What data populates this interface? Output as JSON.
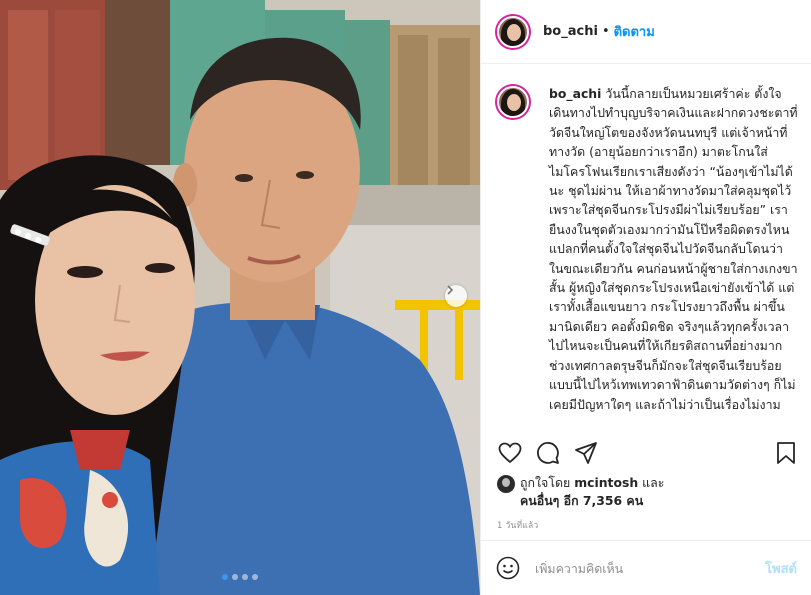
{
  "app": {
    "brand_color": "#0095f6",
    "ring_color": "#d6249f"
  },
  "post_header": {
    "username": "bo_achi",
    "separator": "•",
    "follow_label": "ติดตาม"
  },
  "media": {
    "next_icon": "chevron-right-icon",
    "slide_count": 4,
    "active_slide": 1
  },
  "caption": {
    "username": "bo_achi",
    "text": "วันนี้กลายเป็นหมวยเศร้าค่ะ ตั้งใจเดินทางไปทำบุญบริจาคเงินและฝากดวงชะตาที่วัดจีนใหญ่โตของจังหวัดนนทบุรี แต่เจ้าหน้าที่ทางวัด (อายุน้อยกว่าเราอีก) มาตะโกนใส่ไมโครโฟนเรียกเราเสียงดังว่า “น้องๆเข้าไม่ได้นะ ชุดไม่ผ่าน ให้เอาผ้าทางวัดมาใส่คลุมชุดไว้ เพราะใส่ชุดจีนกระโปรงมีผ่าไม่เรียบร้อย” เรายืนงงในชุดตัวเองมากว่ามันโป๊หรือผิดตรงไหน แปลกที่คนตั้งใจใส่ชุดจีนไปวัดจีนกลับโดนว่า ในขณะเดียวกัน คนก่อนหน้าผู้ชายใส่กางเกงขาสั้น ผู้หญิงใส่ชุดกระโปรงเหนือเข่ายังเข้าได้ แต่เราทั้งเสื้อแขนยาว กระโปรงยาวถึงพื้น ผ่าขึ้นมานิดเดียว คอตั้งมิดชิด จริงๆแล้วทุกครั้งเวลาไปไหนจะเป็นคนที่ให้เกียรติสถานที่อย่างมาก ช่วงเทศกาลตรุษจีนก็มักจะใส่ชุดจีนเรียบร้อยแบบนี้ไปไหว้เทพเทวดาฟ้าดินตามวัดต่างๆ ก็ไม่เคยมีปัญหาใดๆ และถ้าไม่ว่าเป็นเรื่องไม่งาม"
  },
  "actions": {
    "like_icon": "heart-icon",
    "comment_icon": "speech-bubble-icon",
    "share_icon": "paper-plane-icon",
    "save_icon": "bookmark-icon"
  },
  "likes": {
    "prefix": "ถูกใจโดย",
    "first_user": "mcintosh",
    "conjunction": "และ",
    "others_label": "คนอื่นๆ อีก 7,356 คน"
  },
  "timestamp": "1 วันที่แล้ว",
  "comment_box": {
    "emoji_icon": "smiley-icon",
    "placeholder": "เพิ่มความคิดเห็น",
    "post_label": "โพสต์"
  }
}
